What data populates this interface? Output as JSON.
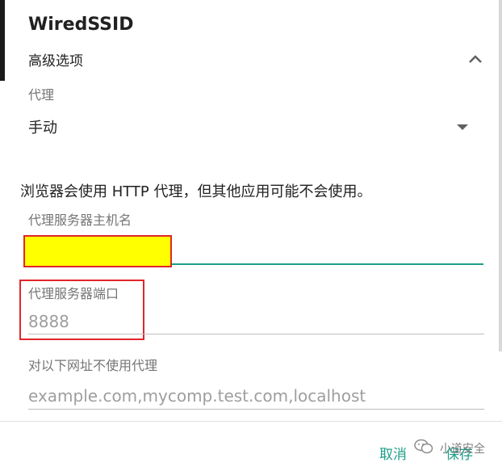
{
  "dialog": {
    "title": "WiredSSID",
    "advanced_label": "高级选项",
    "proxy_label": "代理",
    "proxy_value": "手动",
    "notice": "浏览器会使用 HTTP 代理，但其他应用可能不会使用。",
    "host_label": "代理服务器主机名",
    "host_value": "",
    "port_label": "代理服务器端口",
    "port_placeholder": "8888",
    "bypass_label": "对以下网址不使用代理",
    "bypass_placeholder": "example.com,mycomp.test.com,localhost",
    "cancel_label": "取消",
    "save_label": "保存"
  },
  "watermark": {
    "text": "小道安全",
    "icon": "wechat-icon"
  },
  "colors": {
    "accent": "#1f9e8a",
    "highlight": "#ffff00",
    "annotation_border": "#e0262a"
  }
}
